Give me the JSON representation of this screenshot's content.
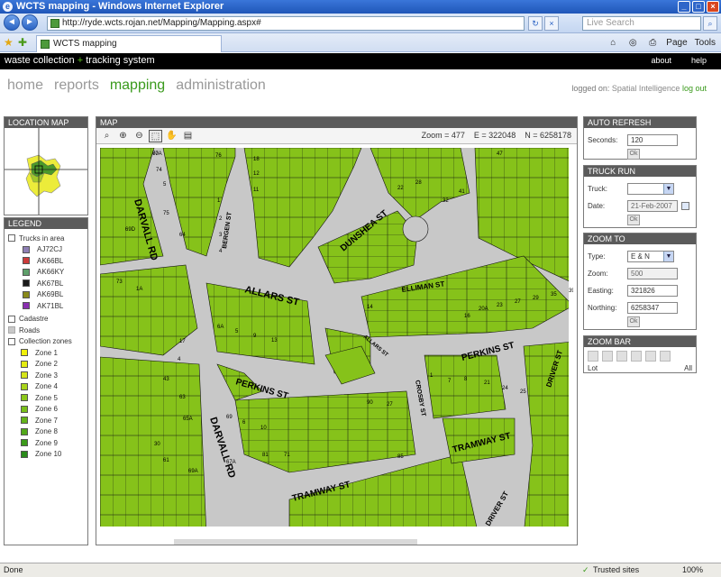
{
  "window": {
    "title": "WCTS mapping - Windows Internet Explorer"
  },
  "browser": {
    "url": "http://ryde.wcts.rojan.net/Mapping/Mapping.aspx#",
    "search_placeholder": "Live Search",
    "tab_title": "WCTS mapping",
    "page_menu": "Page",
    "tools_menu": "Tools"
  },
  "site": {
    "logo_part1": "waste collection",
    "logo_plus": "+",
    "logo_part2": "tracking system",
    "links": [
      "about",
      "help"
    ],
    "nav": [
      "home",
      "reports",
      "mapping",
      "administration"
    ],
    "active_nav": "mapping",
    "logged_on_label": "logged on:",
    "logged_on_user": "Spatial Intelligence",
    "logout": "log out"
  },
  "location_map": {
    "title": "LOCATION MAP"
  },
  "legend": {
    "title": "LEGEND",
    "trucks_label": "Trucks in area",
    "trucks": [
      {
        "name": "AJ72CJ",
        "color": "#8e7fb5"
      },
      {
        "name": "AK66BL",
        "color": "#cc3a3a"
      },
      {
        "name": "AK66KY",
        "color": "#5e9f6a"
      },
      {
        "name": "AK67BL",
        "color": "#1a1a1a"
      },
      {
        "name": "AK69BL",
        "color": "#8a8a1a"
      },
      {
        "name": "AK71BL",
        "color": "#8a2fb0"
      }
    ],
    "cadastre": "Cadastre",
    "roads": "Roads",
    "zones_label": "Collection zones",
    "zones": [
      {
        "name": "Zone 1",
        "color": "#f1f10a"
      },
      {
        "name": "Zone 2",
        "color": "#e4ec11"
      },
      {
        "name": "Zone 3",
        "color": "#d5e41a"
      },
      {
        "name": "Zone 4",
        "color": "#a9d41a"
      },
      {
        "name": "Zone 5",
        "color": "#8cc71a"
      },
      {
        "name": "Zone 6",
        "color": "#79bf1a"
      },
      {
        "name": "Zone 7",
        "color": "#64b41a"
      },
      {
        "name": "Zone 8",
        "color": "#52a81a"
      },
      {
        "name": "Zone 9",
        "color": "#3c9a1a"
      },
      {
        "name": "Zone 10",
        "color": "#2a8a1a"
      }
    ]
  },
  "map": {
    "title": "MAP",
    "zoom_label": "Zoom = 477",
    "easting_label": "E = 322048",
    "northing_label": "N = 6258178",
    "streets": [
      "DARVALL RD",
      "ALLARS ST",
      "DUNSHEA ST",
      "ELLIMAN ST",
      "PERKINS ST",
      "PERKINS ST",
      "TRAMWAY ST",
      "TRAMWAY ST",
      "DRIVER ST",
      "DRIVER ST",
      "CROSBY ST",
      "DARVALL RD",
      "BERGEN ST",
      "ALLARS ST"
    ],
    "lot_numbers": [
      "70",
      "76",
      "74",
      "5",
      "18",
      "12",
      "11",
      "75",
      "69D",
      "64",
      "1",
      "2",
      "3",
      "4",
      "22",
      "28",
      "32",
      "41",
      "47",
      "73",
      "1A",
      "6A",
      "5",
      "9",
      "13",
      "17",
      "69",
      "6",
      "10",
      "14",
      "16",
      "20A",
      "23",
      "27",
      "29",
      "35",
      "39",
      "43",
      "4",
      "63",
      "65A",
      "67A",
      "81",
      "71",
      "85",
      "90",
      "27",
      "1",
      "7",
      "8",
      "21",
      "24",
      "25",
      "30",
      "61",
      "69A",
      "67A"
    ]
  },
  "auto_refresh": {
    "title": "AUTO REFRESH",
    "seconds_label": "Seconds:",
    "seconds_value": "120",
    "ok": "Ok"
  },
  "truck_run": {
    "title": "TRUCK RUN",
    "truck_label": "Truck:",
    "truck_value": "",
    "date_label": "Date:",
    "date_value": "21-Feb-2007",
    "ok": "Ok"
  },
  "zoom_to": {
    "title": "ZOOM TO",
    "type_label": "Type:",
    "type_value": "E & N",
    "zoom_label": "Zoom:",
    "zoom_value": "500",
    "easting_label": "Easting:",
    "easting_value": "321826",
    "northing_label": "Northing:",
    "northing_value": "6258347",
    "ok": "Ok"
  },
  "zoom_bar": {
    "title": "ZOOM BAR",
    "min_label": "Lot",
    "max_label": "All",
    "steps": 6
  },
  "status": {
    "done": "Done",
    "zone": "Trusted sites",
    "zoom": "100%"
  },
  "colors": {
    "parcel": "#86c21a",
    "road": "#c8c8c8",
    "active_nav": "#3a9a1c"
  }
}
